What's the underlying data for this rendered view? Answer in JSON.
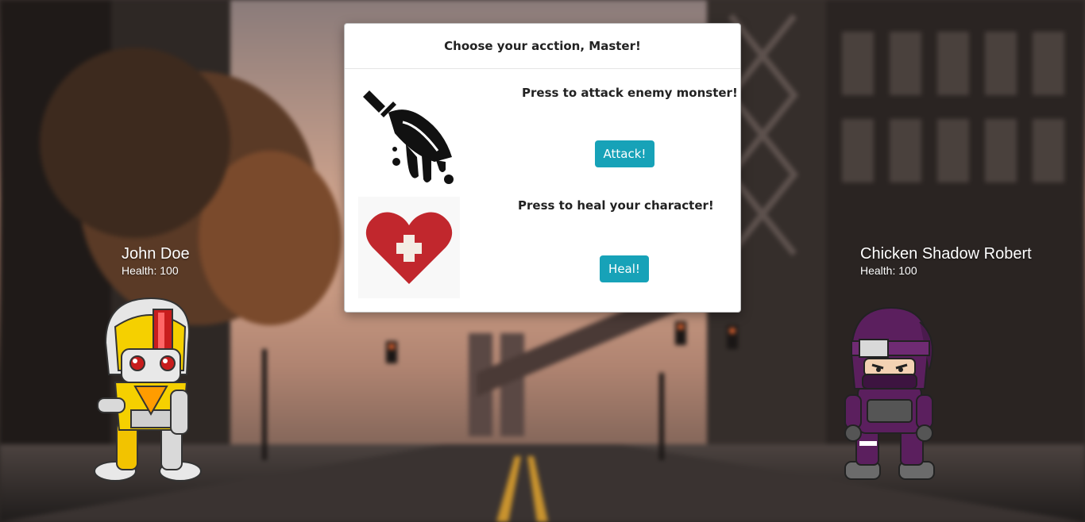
{
  "modal": {
    "title": "Choose your acction, Master!",
    "attack": {
      "text": "Press to attack enemy monster!",
      "button_label": "Attack!",
      "icon": "sword-blood-icon"
    },
    "heal": {
      "text": "Press to heal your character!",
      "button_label": "Heal!",
      "icon": "heart-cross-icon"
    }
  },
  "player": {
    "name": "John Doe",
    "health_label": "Health: 100",
    "sprite": "robot-knight-sprite"
  },
  "enemy": {
    "name": "Chicken Shadow Robert",
    "health_label": "Health: 100",
    "sprite": "ninja-sprite"
  },
  "colors": {
    "button": "#17a2b8",
    "heart": "#c1272d"
  }
}
